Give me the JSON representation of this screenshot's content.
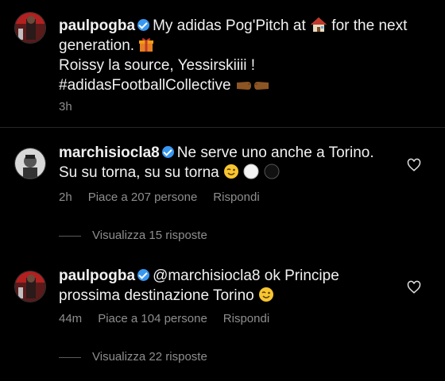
{
  "caption": {
    "username": "paulpogba",
    "line1a": "My adidas Pog'Pitch at",
    "line1b": "for the next",
    "line2": "generation.",
    "line3": "Roissy la source, Yessirskiiii !",
    "line4": "#adidasFootballCollective",
    "time": "3h",
    "icons": [
      "house-emoji",
      "gift-emoji",
      "fist-bump-emoji"
    ]
  },
  "comments": [
    {
      "username": "marchisiocla8",
      "line1": "Ne serve uno anche a Torino.",
      "line2": "Su su torna, su su torna",
      "time": "2h",
      "likes": "Piace a 207 persone",
      "reply": "Rispondi",
      "view_replies": "Visualizza 15 risposte",
      "icons": [
        "winking-face-emoji",
        "white-circle-emoji",
        "black-circle-emoji"
      ]
    },
    {
      "username": "paulpogba",
      "line1": "@marchisiocla8 ok Principe",
      "line2": "prossima destinazione Torino",
      "time": "44m",
      "likes": "Piace a 104 persone",
      "reply": "Rispondi",
      "view_replies": "Visualizza 22 risposte",
      "icons": [
        "winking-face-emoji"
      ]
    }
  ],
  "colors": {
    "background": "#000000",
    "text": "#f1f1f1",
    "muted": "#8e8e8e",
    "verified": "#3897f0"
  }
}
